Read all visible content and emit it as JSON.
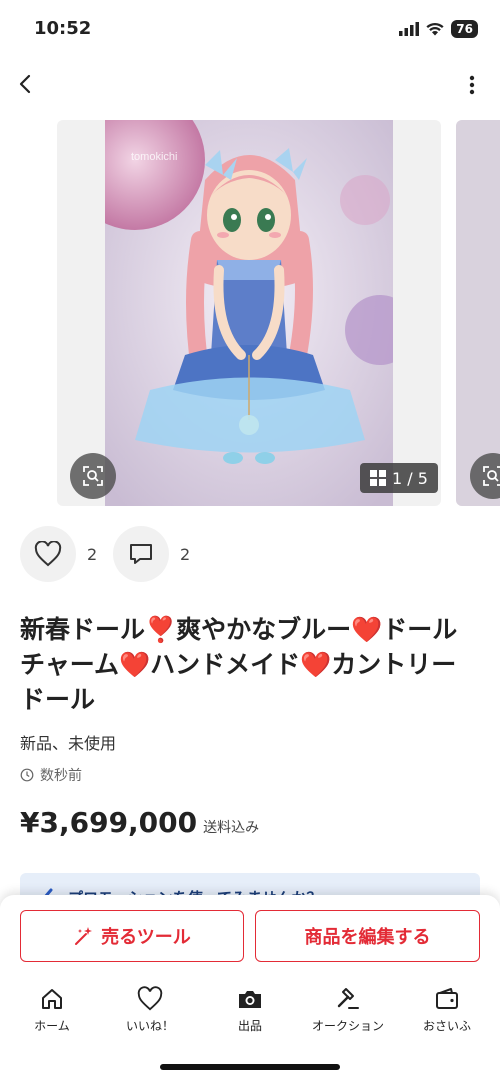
{
  "status_bar": {
    "time": "10:52",
    "battery": "76"
  },
  "gallery": {
    "watermark": "tomokichi",
    "counter": "1 / 5"
  },
  "actions": {
    "likes": "2",
    "comments": "2"
  },
  "item": {
    "title": "新春ドール❣️爽やかなブルー❤️ドールチャーム❤️ハンドメイド❤️カントリードール",
    "condition": "新品、未使用",
    "posted": "数秒前",
    "price": "¥3,699,000",
    "shipping_note": "送料込み"
  },
  "promo": {
    "text": "プロモーションを使ってみませんか？"
  },
  "buttons": {
    "sell_tool": "売るツール",
    "edit_item": "商品を編集する"
  },
  "tabs": [
    {
      "label": "ホーム",
      "icon": "home-icon"
    },
    {
      "label": "いいね！",
      "icon": "heart-icon"
    },
    {
      "label": "出品",
      "icon": "camera-icon"
    },
    {
      "label": "オークション",
      "icon": "gavel-icon"
    },
    {
      "label": "おさいふ",
      "icon": "wallet-icon"
    }
  ],
  "colors": {
    "accent": "#e32b36",
    "promo_bg": "#e6eef9"
  }
}
